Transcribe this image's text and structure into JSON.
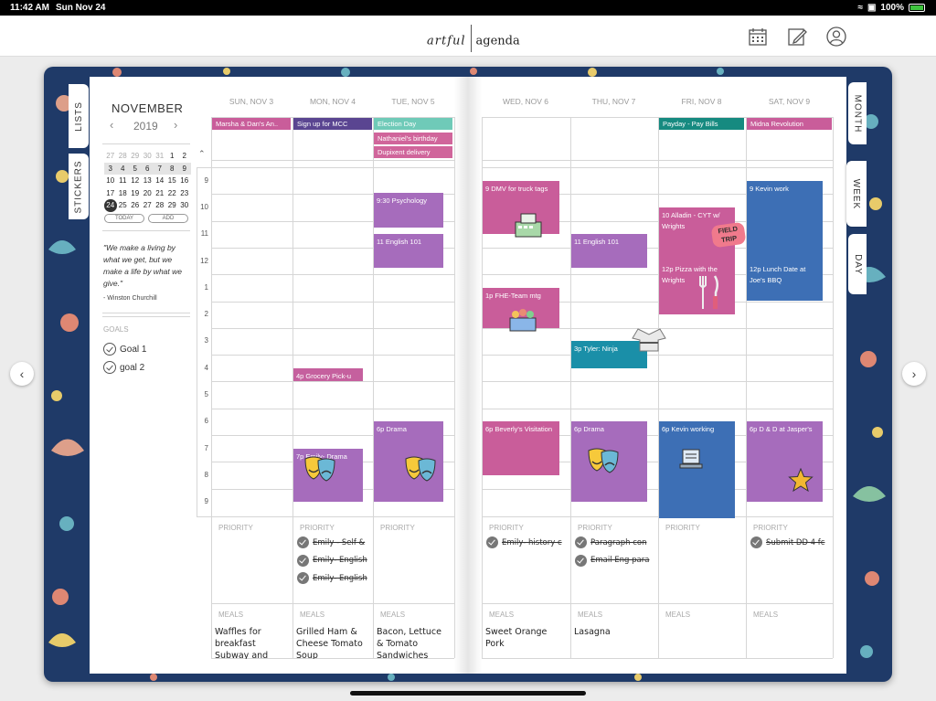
{
  "status": {
    "time": "11:42 AM",
    "date": "Sun Nov 24",
    "battery": "100%"
  },
  "app": {
    "logo_left": "artful",
    "logo_right": "agenda"
  },
  "tabs_left": {
    "lists": "LISTS",
    "stickers": "STICKERS"
  },
  "tabs_right": {
    "month": "MONTH",
    "week": "WEEK",
    "day": "DAY"
  },
  "mini": {
    "month": "NOVEMBER",
    "year": "2019",
    "today": "TODAY",
    "add": "ADD",
    "rows": [
      [
        "27",
        "28",
        "29",
        "30",
        "31",
        "1",
        "2"
      ],
      [
        "3",
        "4",
        "5",
        "6",
        "7",
        "8",
        "9"
      ],
      [
        "10",
        "11",
        "12",
        "13",
        "14",
        "15",
        "16"
      ],
      [
        "17",
        "18",
        "19",
        "20",
        "21",
        "22",
        "23"
      ],
      [
        "24",
        "25",
        "26",
        "27",
        "28",
        "29",
        "30"
      ]
    ]
  },
  "quote": {
    "text": "\"We make a living by what we get, but we make a life by what we give.\"",
    "author": "- Winston Churchill"
  },
  "goals": {
    "heading": "GOALS",
    "items": [
      "Goal 1",
      "goal 2"
    ]
  },
  "days": [
    "SUN, NOV 3",
    "MON, NOV 4",
    "TUE, NOV 5",
    "WED, NOV 6",
    "THU, NOV 7",
    "FRI, NOV 8",
    "SAT, NOV 9"
  ],
  "hours": [
    "9",
    "10",
    "11",
    "12",
    "1",
    "2",
    "3",
    "4",
    "5",
    "6",
    "7",
    "8",
    "9"
  ],
  "allday": [
    {
      "day": 0,
      "row": 0,
      "text": "Marsha & Dan's An..",
      "color": "#c95d9a"
    },
    {
      "day": 1,
      "row": 0,
      "text": "Sign up for MCC",
      "color": "#5a4591"
    },
    {
      "day": 2,
      "row": 0,
      "text": "Election Day",
      "color": "#6fcab8"
    },
    {
      "day": 2,
      "row": 1,
      "text": "Nathaniel's birthday",
      "color": "#d0659b"
    },
    {
      "day": 2,
      "row": 2,
      "text": "Dupixent delivery",
      "color": "#d0659b"
    },
    {
      "day": 5,
      "row": 0,
      "text": "Payday - Pay Bills",
      "color": "#168a80"
    },
    {
      "day": 6,
      "row": 0,
      "text": "Midna Revolution",
      "color": "#c95d9a"
    }
  ],
  "events": [
    {
      "day": 2,
      "start": 9.45,
      "end": 10.75,
      "text": "9:30 Psychology",
      "color": "#a66cbc"
    },
    {
      "day": 2,
      "start": 11,
      "end": 12.25,
      "text": "11 English 101",
      "color": "#a66cbc"
    },
    {
      "day": 1,
      "start": 16,
      "end": 16.5,
      "text": "4p Grocery Pick-u",
      "color": "#c5609e"
    },
    {
      "day": 1,
      "start": 19,
      "end": 21,
      "text": "7p Emily- Drama",
      "color": "#a66cbc"
    },
    {
      "day": 2,
      "start": 18,
      "end": 21,
      "text": "6p Drama",
      "color": "#a66cbc"
    },
    {
      "day": 3,
      "start": 9,
      "end": 11,
      "text": "9 DMV for truck tags",
      "color": "#c95d9a"
    },
    {
      "day": 3,
      "start": 13,
      "end": 14.5,
      "text": "1p FHE-Team mtg",
      "color": "#c95d9a"
    },
    {
      "day": 3,
      "start": 18,
      "end": 20,
      "text": "6p Beverly's Visitation",
      "color": "#c95d9a"
    },
    {
      "day": 4,
      "start": 11,
      "end": 12.25,
      "text": "11 English 101",
      "color": "#a66cbc"
    },
    {
      "day": 4,
      "start": 15,
      "end": 16,
      "text": "3p Tyler: Ninja",
      "color": "#1a8fa8"
    },
    {
      "day": 4,
      "start": 18,
      "end": 21,
      "text": "6p Drama",
      "color": "#a66cbc"
    },
    {
      "day": 5,
      "start": 10,
      "end": 12,
      "text": "10 Alladin - CYT w/ Wrights",
      "color": "#c95d9a"
    },
    {
      "day": 5,
      "start": 12,
      "end": 14,
      "text": "12p Pizza with the Wrights",
      "color": "#c95d9a"
    },
    {
      "day": 5,
      "start": 18,
      "end": 21.6,
      "text": "6p Kevin working",
      "color": "#3d6fb5"
    },
    {
      "day": 6,
      "start": 9,
      "end": 12,
      "text": "9 Kevin work",
      "color": "#3d6fb5"
    },
    {
      "day": 6,
      "start": 12,
      "end": 13.5,
      "text": "12p Lunch Date at Joe's BBQ",
      "color": "#3d6fb5"
    },
    {
      "day": 6,
      "start": 18,
      "end": 21,
      "text": "6p D & D at Jasper's",
      "color": "#a66cbc"
    }
  ],
  "priority_label": "PRIORITY",
  "meals_label": "MEALS",
  "tasks": [
    {
      "day": 1,
      "i": 0,
      "text": "Emily - Self &"
    },
    {
      "day": 1,
      "i": 1,
      "text": "Emily- English"
    },
    {
      "day": 1,
      "i": 2,
      "text": "Emily- English"
    },
    {
      "day": 3,
      "i": 0,
      "text": "Emily- history c"
    },
    {
      "day": 4,
      "i": 0,
      "text": "Paragraph con"
    },
    {
      "day": 4,
      "i": 1,
      "text": "Email Eng para"
    },
    {
      "day": 6,
      "i": 0,
      "text": "Submit DD 4 fc"
    }
  ],
  "meals": [
    {
      "day": 0,
      "text": "Waffles for breakfast Subway and"
    },
    {
      "day": 1,
      "text": "Grilled Ham & Cheese Tomato Soup"
    },
    {
      "day": 2,
      "text": "Bacon, Lettuce & Tomato Sandwiches"
    },
    {
      "day": 3,
      "text": "Sweet Orange Pork"
    },
    {
      "day": 4,
      "text": "Lasagna"
    }
  ],
  "stickers": {
    "field_trip": "FIELD TRIP"
  },
  "colors": {
    "cover": "#1f3a68",
    "accent_pink": "#c95d9a",
    "accent_purple": "#a66cbc",
    "accent_blue": "#3d6fb5",
    "accent_teal": "#6fcab8"
  }
}
